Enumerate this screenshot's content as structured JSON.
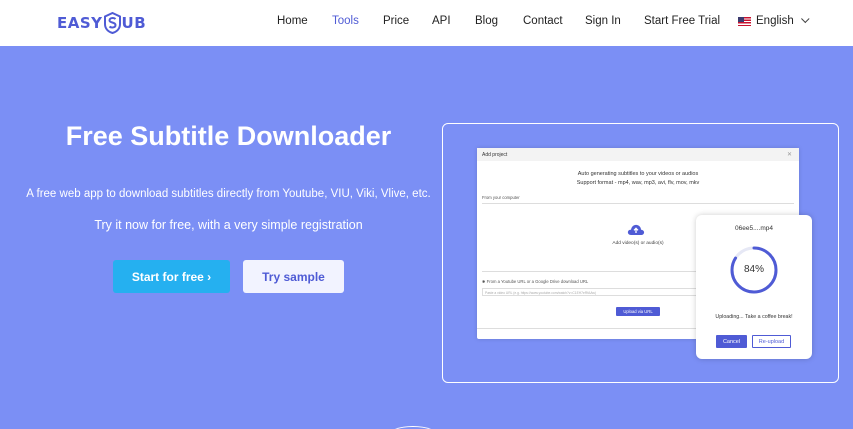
{
  "header": {
    "logo_left": "EASY",
    "logo_right": "UB",
    "nav": [
      {
        "label": "Home",
        "active": false
      },
      {
        "label": "Tools",
        "active": true
      },
      {
        "label": "Price",
        "active": false
      },
      {
        "label": "API",
        "active": false
      },
      {
        "label": "Blog",
        "active": false
      },
      {
        "label": "Contact",
        "active": false
      },
      {
        "label": "Sign In",
        "active": false
      },
      {
        "label": "Start Free Trial",
        "active": false
      }
    ],
    "language": "English",
    "flag_icon": "us-flag-icon"
  },
  "hero": {
    "title": "Free Subtitle Downloader",
    "subtitle": "A free web app to download subtitles directly from Youtube, VIU, Viki, Vlive, etc.",
    "tagline": "Try it now for free, with a very simple registration",
    "start_button": "Start for free ›",
    "try_button": "Try sample",
    "background": "#7b8ff5",
    "accent": "#4f5bd5",
    "start_color": "#25b0f0"
  },
  "mock": {
    "dialog_title": "Add project",
    "auto_line1": "Auto generating subtitles to your videos or audios",
    "auto_line2": "Support format - mp4, wav, mp3, avi, flv, mov, mkv",
    "from_computer": "From your computer",
    "add_files": "Add video(s) or audio(s)",
    "url_label": "✱ From a Youtube URL or a Google Drive download URL",
    "url_placeholder": "Paste a video URL (e.g. https://www.youtube.com/watch?v=C1EH7eRfAAw)",
    "url_button": "Upload via URL",
    "card_filename": "06ee5....mp4",
    "progress_percent": "84%",
    "progress_fraction": 0.84,
    "card_message": "Uploading... Take a coffee break!",
    "cancel_button": "Cancel",
    "reupload_button": "Re-upload"
  }
}
